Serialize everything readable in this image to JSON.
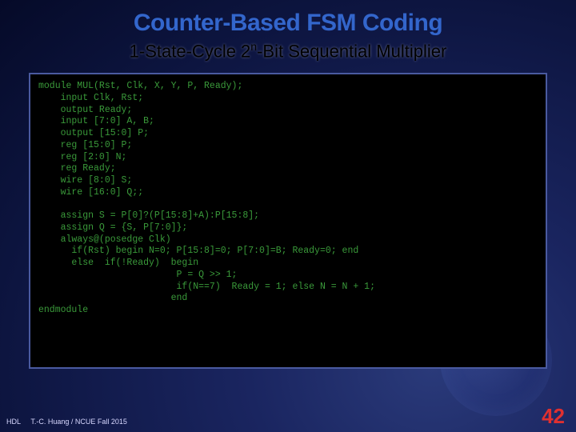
{
  "title": "Counter-Based FSM Coding",
  "subtitle_prefix": "1-State-Cycle 2",
  "subtitle_sup": "n",
  "subtitle_suffix": "-Bit Sequential Multiplier",
  "code": "module MUL(Rst, Clk, X, Y, P, Ready);\n    input Clk, Rst;\n    output Ready;\n    input [7:0] A, B;\n    output [15:0] P;\n    reg [15:0] P;\n    reg [2:0] N;\n    reg Ready;\n    wire [8:0] S;\n    wire [16:0] Q;;\n\n    assign S = P[0]?(P[15:8]+A):P[15:8];\n    assign Q = {S, P[7:0]};\n    always@(posedge Clk)\n      if(Rst) begin N=0; P[15:8]=0; P[7:0]=B; Ready=0; end\n      else  if(!Ready)  begin\n                         P = Q >> 1;\n                         if(N==7)  Ready = 1; else N = N + 1;\n                        end\nendmodule",
  "footer": {
    "hdl": "HDL",
    "credit": "T.-C. Huang / NCUE  Fall 2015"
  },
  "page": "42"
}
